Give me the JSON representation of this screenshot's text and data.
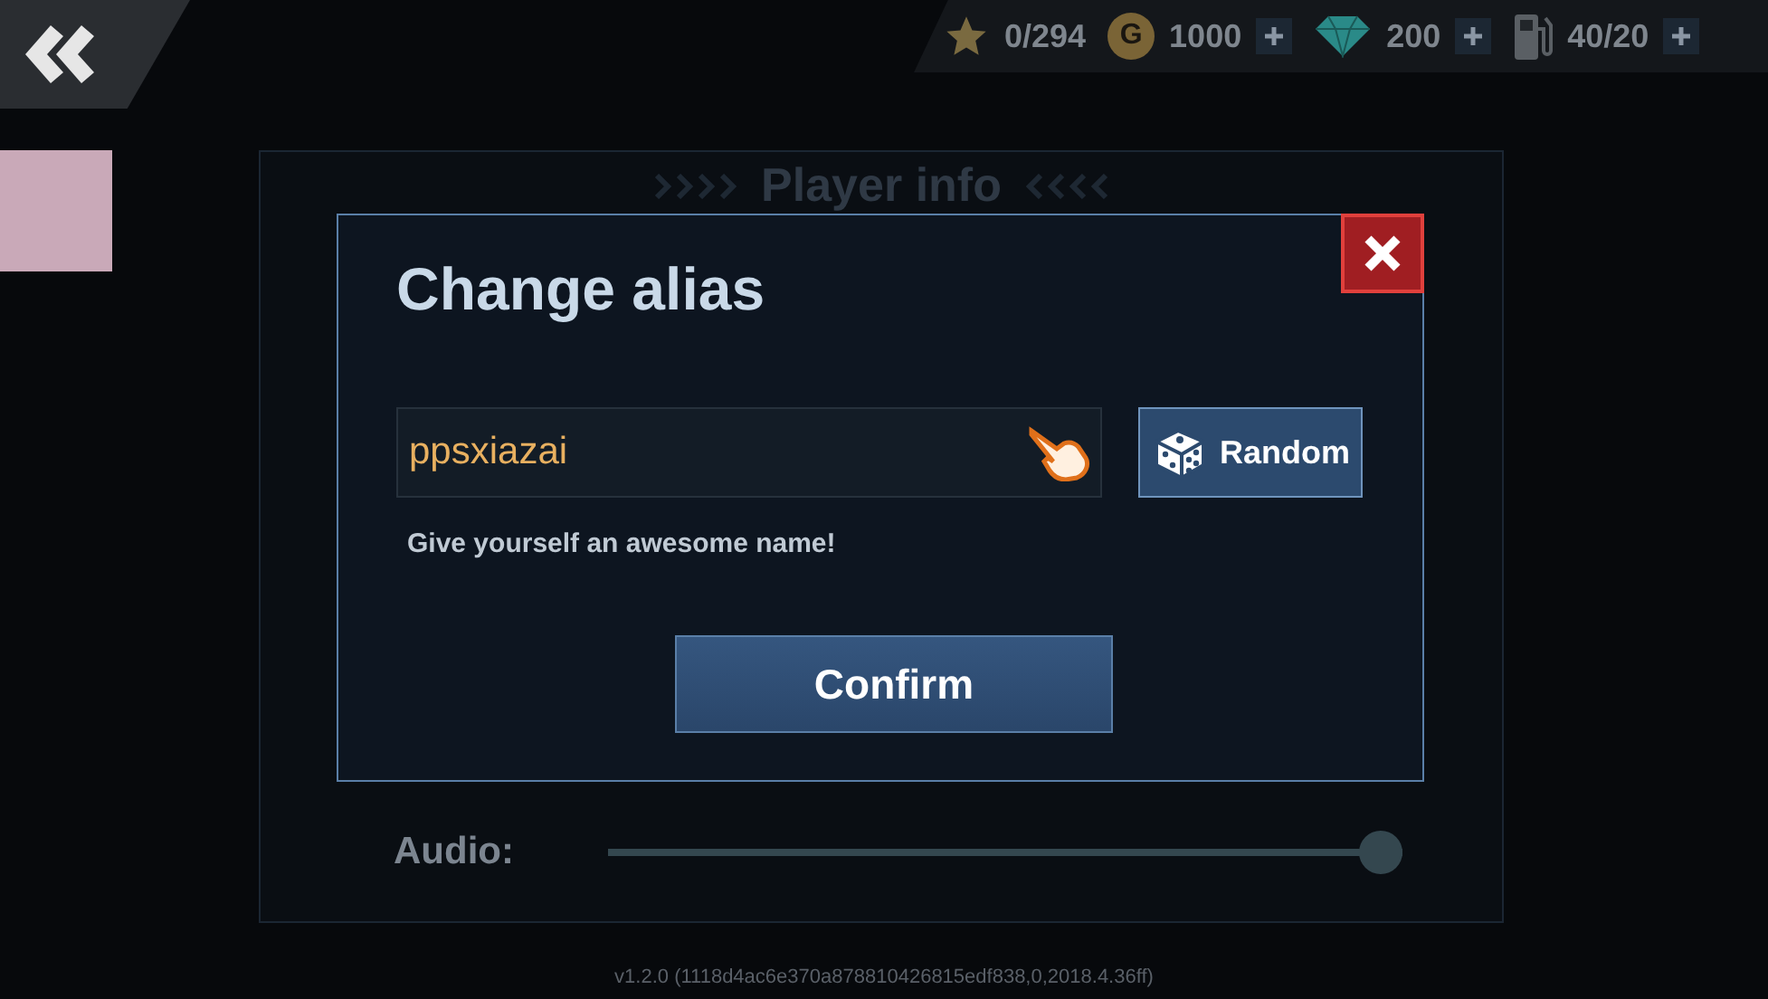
{
  "top_bar": [
    {
      "kind": "stars",
      "value": "0/294",
      "plus": false
    },
    {
      "kind": "gold",
      "badge": "G",
      "value": "1000",
      "plus": true
    },
    {
      "kind": "gems",
      "value": "200",
      "plus": true
    },
    {
      "kind": "fuel",
      "value": "40/20",
      "plus": true
    }
  ],
  "settings_panel": {
    "title": "Player info",
    "audio": {
      "label": "Audio:",
      "level": 1.0
    }
  },
  "version": "v1.2.0 (1118d4ac6e370a878810426815edf838,0,2018.4.36ff)",
  "dialog": {
    "title": "Change alias",
    "name_field": {
      "value": "ppsxiazai"
    },
    "random_button": "Random",
    "hint": "Give yourself an awesome name!",
    "confirm_button": "Confirm"
  }
}
